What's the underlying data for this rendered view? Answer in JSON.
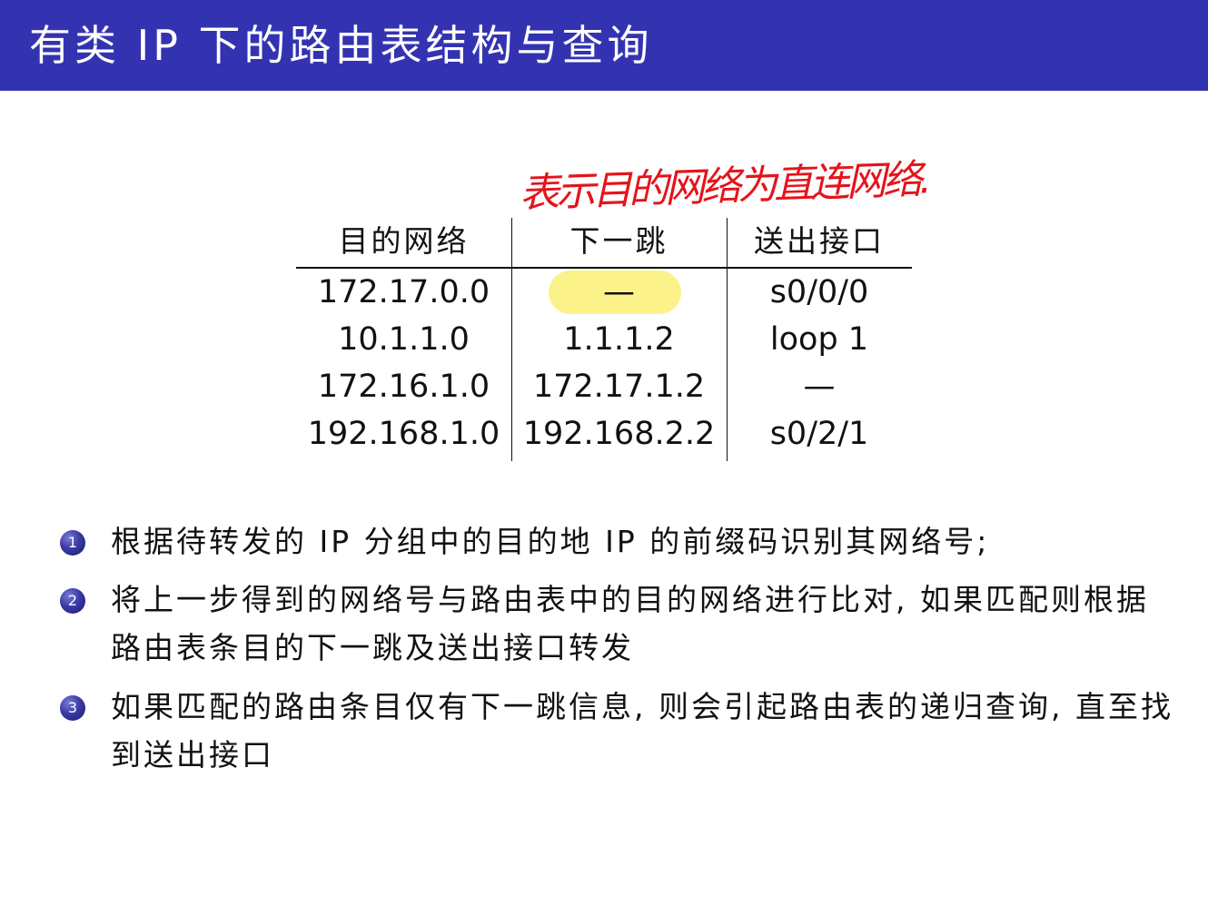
{
  "slide": {
    "title": "有类 IP 下的路由表结构与查询",
    "annotation": "表示目的网络为直连网络."
  },
  "table": {
    "headers": [
      "目的网络",
      "下一跳",
      "送出接口"
    ],
    "rows": [
      [
        "172.17.0.0",
        "—",
        "s0/0/0"
      ],
      [
        "10.1.1.0",
        "1.1.1.2",
        "loop 1"
      ],
      [
        "172.16.1.0",
        "172.17.1.2",
        "—"
      ],
      [
        "192.168.1.0",
        "192.168.2.2",
        "s0/2/1"
      ]
    ],
    "highlight_color": "#fbf28a"
  },
  "steps": [
    {
      "number": "1",
      "text": "根据待转发的 IP 分组中的目的地 IP 的前缀码识别其网络号;"
    },
    {
      "number": "2",
      "text": "将上一步得到的网络号与路由表中的目的网络进行比对, 如果匹配则根据路由表条目的下一跳及送出接口转发"
    },
    {
      "number": "3",
      "text": "如果匹配的路由条目仅有下一跳信息, 则会引起路由表的递归查询, 直至找到送出接口"
    }
  ],
  "colors": {
    "header_bar": "#3333b2",
    "annotation": "#e4141b"
  }
}
